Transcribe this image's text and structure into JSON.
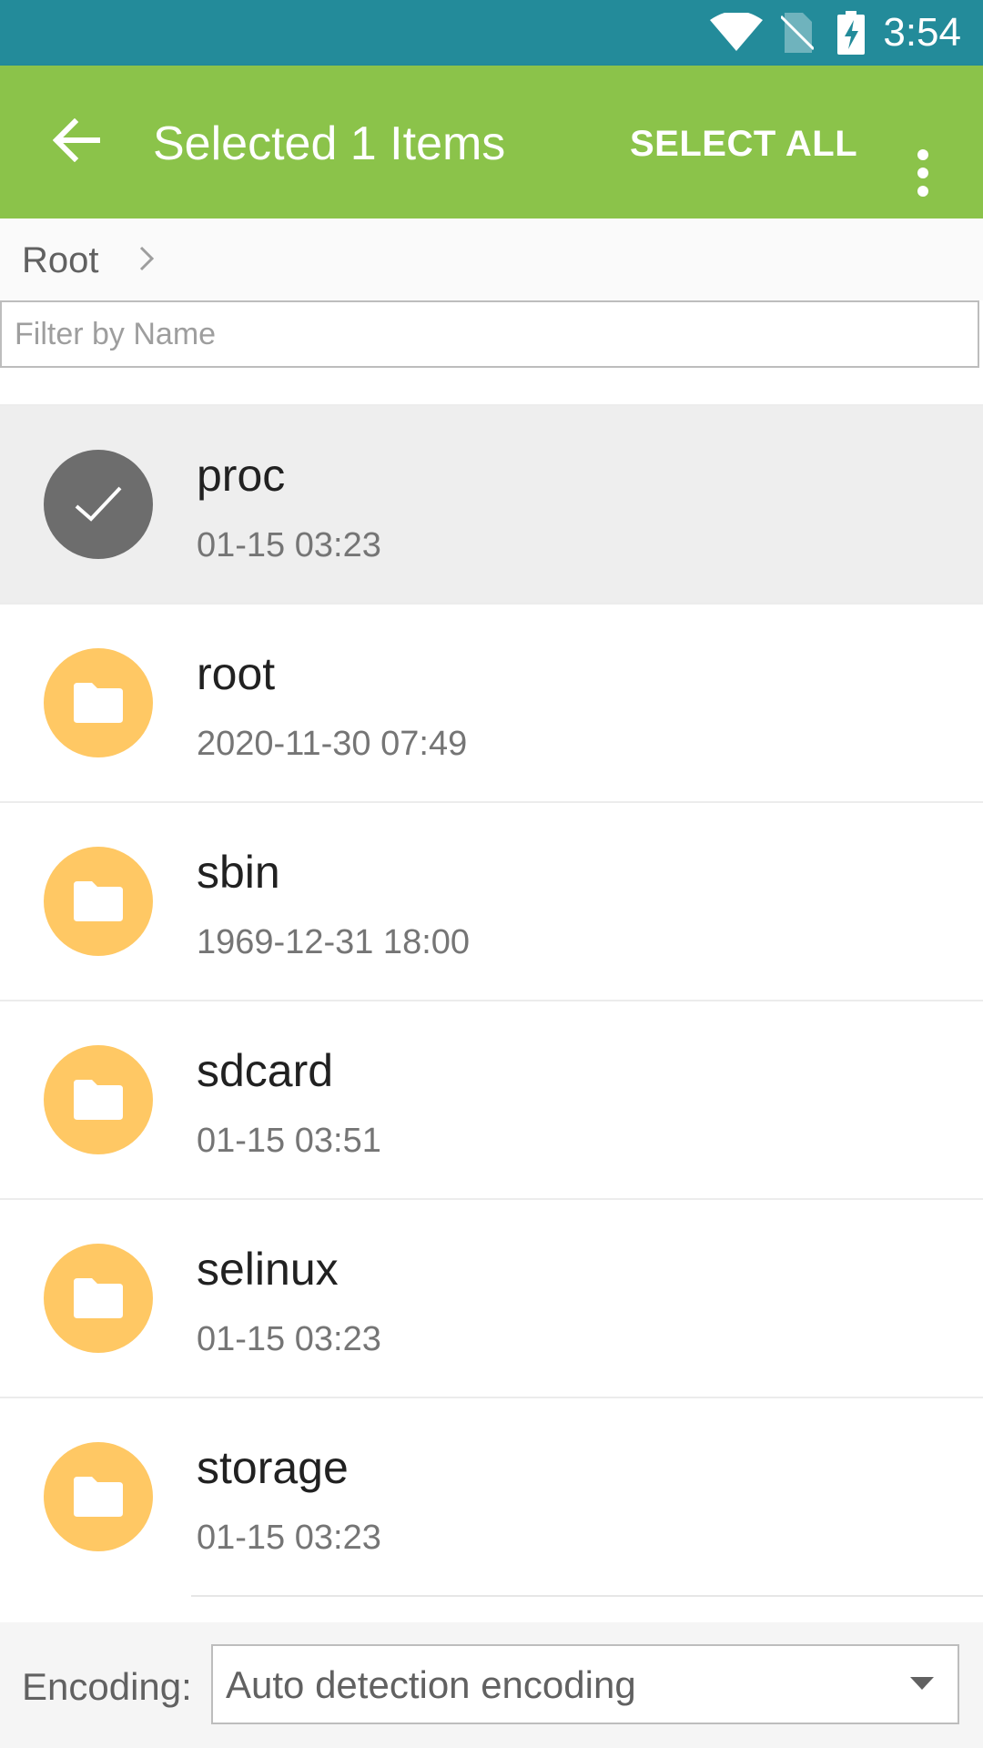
{
  "status_bar": {
    "time": "3:54",
    "icons": [
      "wifi-icon",
      "no-sim-icon",
      "battery-charging-icon"
    ]
  },
  "app_bar": {
    "back_icon": "arrow-left-icon",
    "title": "Selected 1 Items",
    "select_all_label": "SELECT ALL",
    "more_icon": "more-vert-icon"
  },
  "breadcrumb": {
    "label": "Root",
    "chevron_icon": "chevron-right-icon"
  },
  "filter": {
    "value": "",
    "placeholder": "Filter by Name"
  },
  "files": [
    {
      "name": "proc",
      "date": "01-15 03:23",
      "selected": true
    },
    {
      "name": "root",
      "date": "2020-11-30 07:49",
      "selected": false
    },
    {
      "name": "sbin",
      "date": "1969-12-31 18:00",
      "selected": false
    },
    {
      "name": "sdcard",
      "date": "01-15 03:51",
      "selected": false
    },
    {
      "name": "selinux",
      "date": "01-15 03:23",
      "selected": false
    },
    {
      "name": "storage",
      "date": "01-15 03:23",
      "selected": false
    }
  ],
  "encoding": {
    "label": "Encoding:",
    "selected": "Auto detection encoding"
  },
  "colors": {
    "status_bar": "#238b9a",
    "app_bar": "#8bc34a",
    "folder": "#ffc864",
    "selected_check": "#6d6d6d",
    "selected_row": "#eeeeee"
  }
}
